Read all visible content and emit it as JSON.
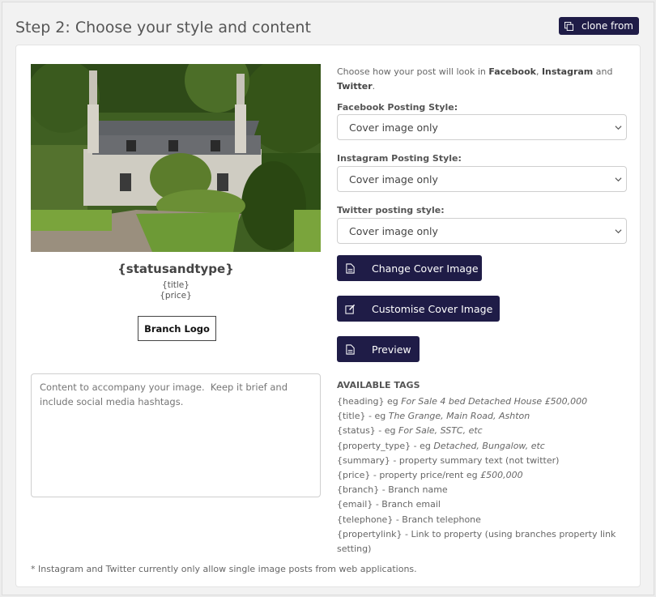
{
  "header": {
    "step_title": "Step 2: Choose your style and content",
    "clone_label": "clone from"
  },
  "preview": {
    "image": "house-photo",
    "heading": "{statusandtype}",
    "title": "{title}",
    "price": "{price}",
    "branch_logo": "Branch Logo"
  },
  "content": {
    "placeholder": "Content to accompany your image.  Keep it brief and include social media hashtags."
  },
  "intro": {
    "prefix": "Choose how your post will look in ",
    "facebook": "Facebook",
    "sep": ", ",
    "instagram": "Instagram",
    "and": " and ",
    "twitter": "Twitter",
    "suffix": "."
  },
  "styles": {
    "facebook_label": "Facebook Posting Style:",
    "facebook_value": "Cover image only",
    "instagram_label": "Instagram Posting Style:",
    "instagram_value": "Cover image only",
    "twitter_label": "Twitter posting style:",
    "twitter_value": "Cover image only"
  },
  "buttons": {
    "change_cover": "Change Cover Image",
    "customise_cover": "Customise Cover Image",
    "preview": "Preview"
  },
  "tags": {
    "heading": "AVAILABLE TAGS",
    "items": [
      {
        "text": "{heading} eg ",
        "example": "For Sale 4 bed Detached House £500,000"
      },
      {
        "text": "{title} - eg ",
        "example": "The Grange, Main Road, Ashton"
      },
      {
        "text": "{status} - eg ",
        "example": "For Sale, SSTC, etc"
      },
      {
        "text": "{property_type} - eg ",
        "example": "Detached, Bungalow, etc"
      },
      {
        "text": "{summary} - property summary text (not twitter)",
        "example": ""
      },
      {
        "text": "{price} - property price/rent eg ",
        "example": "£500,000"
      },
      {
        "text": "{branch} - Branch name",
        "example": ""
      },
      {
        "text": "{email} - Branch email",
        "example": ""
      },
      {
        "text": "{telephone} - Branch telephone",
        "example": ""
      },
      {
        "text": "{propertylink} - Link to property (using branches property link setting)",
        "example": ""
      }
    ]
  },
  "footnote": "* Instagram and Twitter currently only allow single image posts from web applications.",
  "colors": {
    "primary_button": "#1f1c47",
    "page_bg": "#f2f2f2"
  }
}
